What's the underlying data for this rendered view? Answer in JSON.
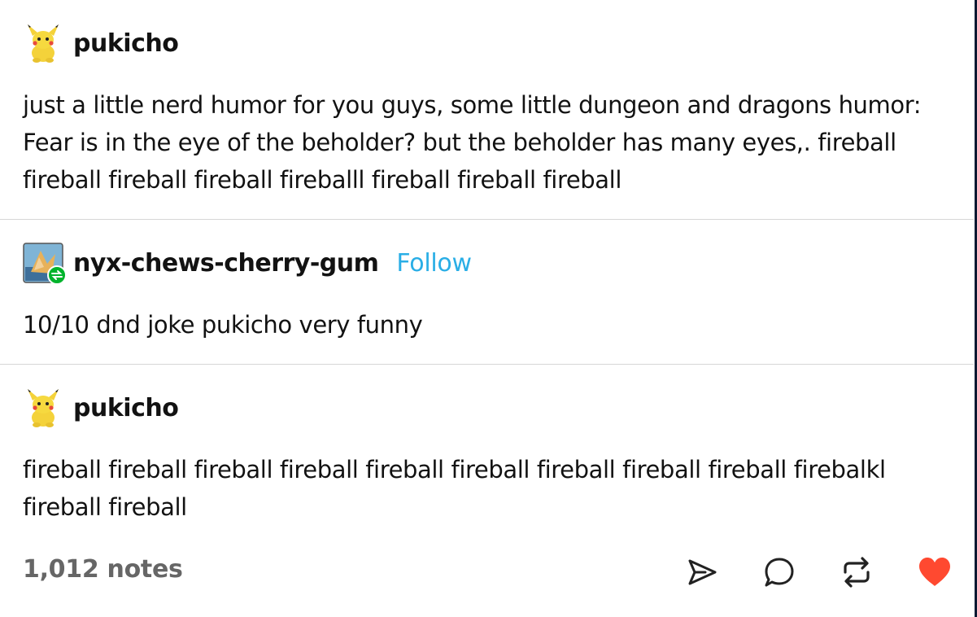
{
  "posts": [
    {
      "username": "pukicho",
      "text": "just a little nerd humor for you guys, some little dungeon and dragons humor: Fear is in the eye of the beholder? but the beholder has many eyes,. fireball fireball fireball fireball fireballl fireball fireball fireball"
    },
    {
      "username": "nyx-chews-cherry-gum",
      "follow_label": "Follow",
      "text": "10/10 dnd joke pukicho very funny"
    },
    {
      "username": "pukicho",
      "text": "fireball fireball fireball fireball fireball fireball fireball fireball fireball firebalkl fireball fireball"
    }
  ],
  "footer": {
    "notes": "1,012 notes",
    "icons": [
      "share-icon",
      "reply-icon",
      "reblog-icon",
      "like-heart-icon"
    ],
    "like_color": "#ff4930"
  },
  "colors": {
    "follow": "#2aaee6",
    "divider": "#d6d6d6",
    "reblog_badge": "#00b32c"
  }
}
